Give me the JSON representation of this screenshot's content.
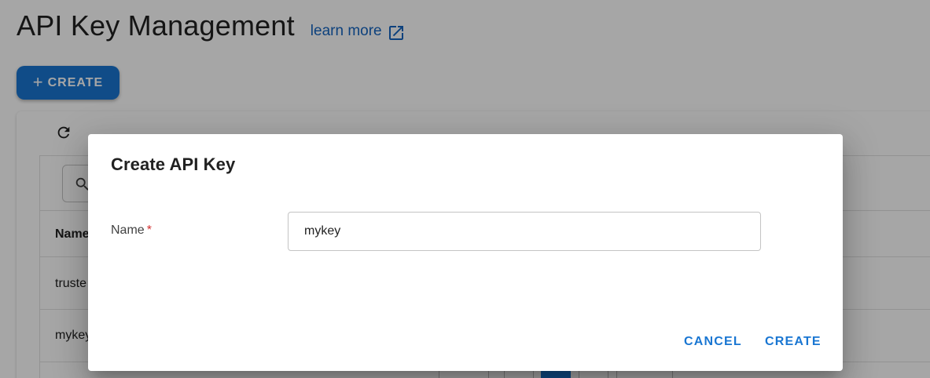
{
  "page": {
    "title": "API Key Management",
    "learn_more": "learn more",
    "create_button": "CREATE"
  },
  "table": {
    "columns": [
      "Name"
    ],
    "rows": [
      {
        "name": "truste"
      },
      {
        "name": "mykey"
      }
    ]
  },
  "dialog": {
    "title": "Create API Key",
    "name_label": "Name",
    "required_mark": "*",
    "name_value": "mykey",
    "cancel_label": "CANCEL",
    "create_label": "CREATE"
  },
  "icons": {
    "learn_more": "open-in-new-icon",
    "create": "plus-icon",
    "refresh": "refresh-icon",
    "search": "search-icon"
  },
  "colors": {
    "accent": "#1976d2",
    "required": "#d32f2f",
    "overlay": "rgba(0,0,0,0.35)"
  }
}
